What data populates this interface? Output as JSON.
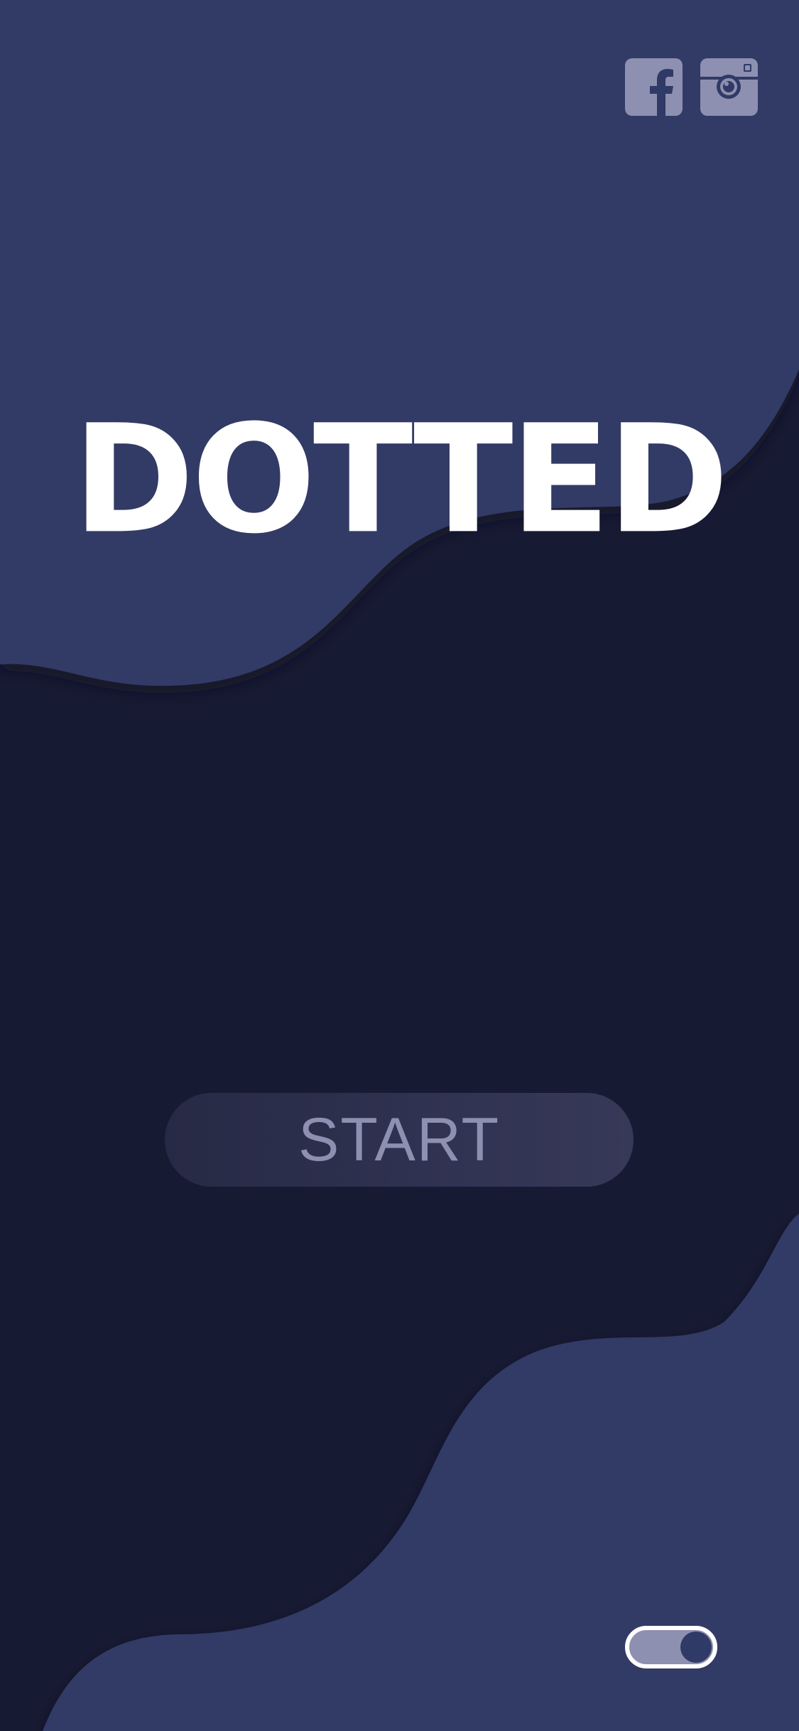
{
  "app": {
    "title": "DOTTED"
  },
  "actions": {
    "start_label": "START"
  },
  "social": [
    {
      "name": "facebook",
      "icon": "facebook-icon"
    },
    {
      "name": "instagram",
      "icon": "instagram-icon"
    }
  ],
  "settings": {
    "toggle_on": true
  },
  "colors": {
    "background_dark": "#171a33",
    "wave_light": "#303a66",
    "icon_tint": "#8d90b0",
    "title": "#ffffff"
  }
}
